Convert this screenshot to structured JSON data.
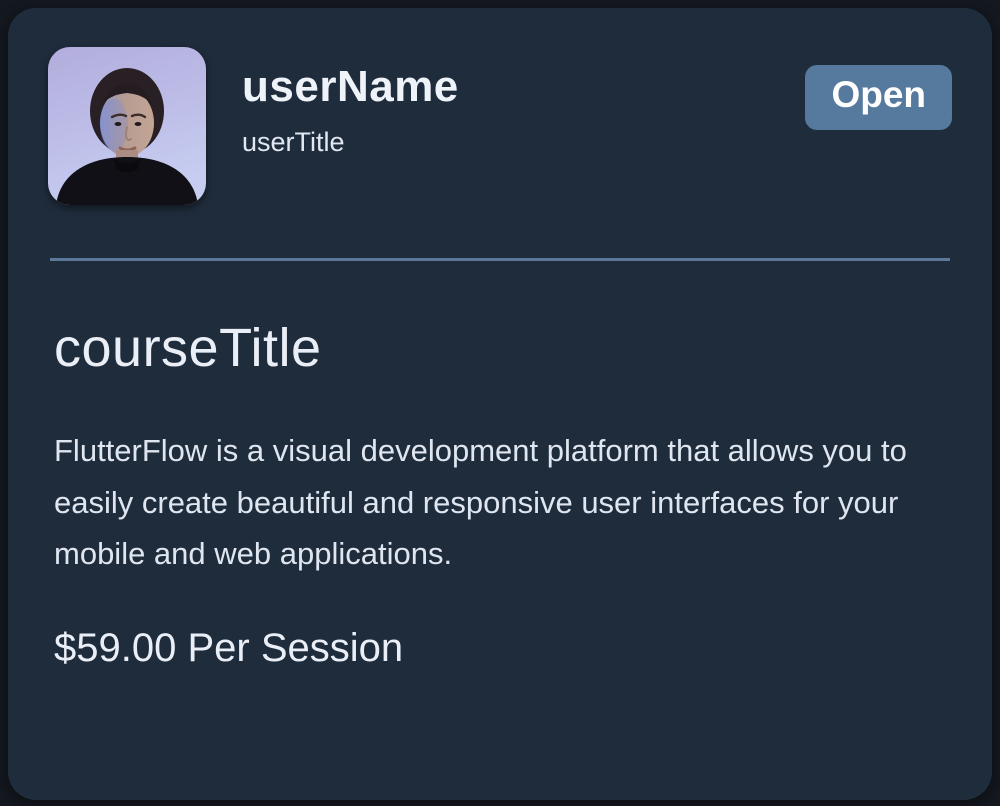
{
  "card": {
    "user": {
      "name": "userName",
      "title": "userTitle",
      "avatar_alt": "user-portrait-photo"
    },
    "actions": {
      "open_label": "Open"
    },
    "course": {
      "title": "courseTitle",
      "description": "FlutterFlow is a visual development platform that allows you to easily create beautiful and responsive user interfaces for your mobile and web applications.",
      "price": "$59.00 Per Session"
    },
    "colors": {
      "outer_background": "#14181f",
      "card_background": "#1f2c3c",
      "accent_button": "#56799e",
      "divider": "#5c7899",
      "text_primary": "#eaeef6"
    }
  }
}
